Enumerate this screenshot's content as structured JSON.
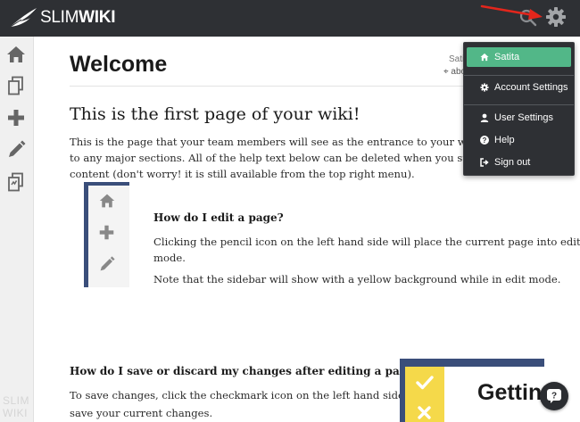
{
  "app": {
    "logo_light": "SLIM",
    "logo_bold": "WIKI",
    "sidebar_watermark_top": "SLIM",
    "sidebar_watermark_bottom": "WIKI"
  },
  "colors": {
    "topbar": "#2e3034",
    "accent_green": "#52b788",
    "edit_yellow": "#f5d94a",
    "sidebar_blue": "#3a4e7a"
  },
  "icons": {
    "top": [
      "search-icon",
      "gear-icon"
    ],
    "sidebar": [
      "home-icon",
      "copy-icon",
      "plus-icon",
      "pencil-icon",
      "history-icon"
    ]
  },
  "page": {
    "title": "Welcome",
    "author": "Satia",
    "about": "abo",
    "heading": "This is the first page of your wiki!",
    "intro_lines": [
      "This is the page that your team members will see as the entrance to your wiki and sho",
      "to any major sections.  All of the help text below can be deleted when you start to buil",
      "content (don't worry! it is still available from the top right menu)."
    ],
    "section1": {
      "title": "How do I edit a page?",
      "lines": [
        "Clicking the pencil icon on the left hand side will place the current page into edit",
        "mode."
      ],
      "note": "Note that the sidebar will show with a yellow background while in edit mode."
    },
    "section2": {
      "title": "How do I save or discard my changes after editing a page?",
      "lines": [
        "To save changes, click the checkmark icon on the left hand side to",
        "save your current changes."
      ],
      "image_text": "Gettin"
    }
  },
  "menu": {
    "items": [
      {
        "label": "Satita",
        "icon": "home-icon",
        "active": true
      },
      {
        "label": "Account Settings",
        "icon": "gear-icon",
        "active": false
      },
      {
        "label": "User Settings",
        "icon": "user-icon",
        "active": false
      },
      {
        "label": "Help",
        "icon": "question-icon",
        "active": false
      },
      {
        "label": "Sign out",
        "icon": "sign-out-icon",
        "active": false
      }
    ]
  }
}
